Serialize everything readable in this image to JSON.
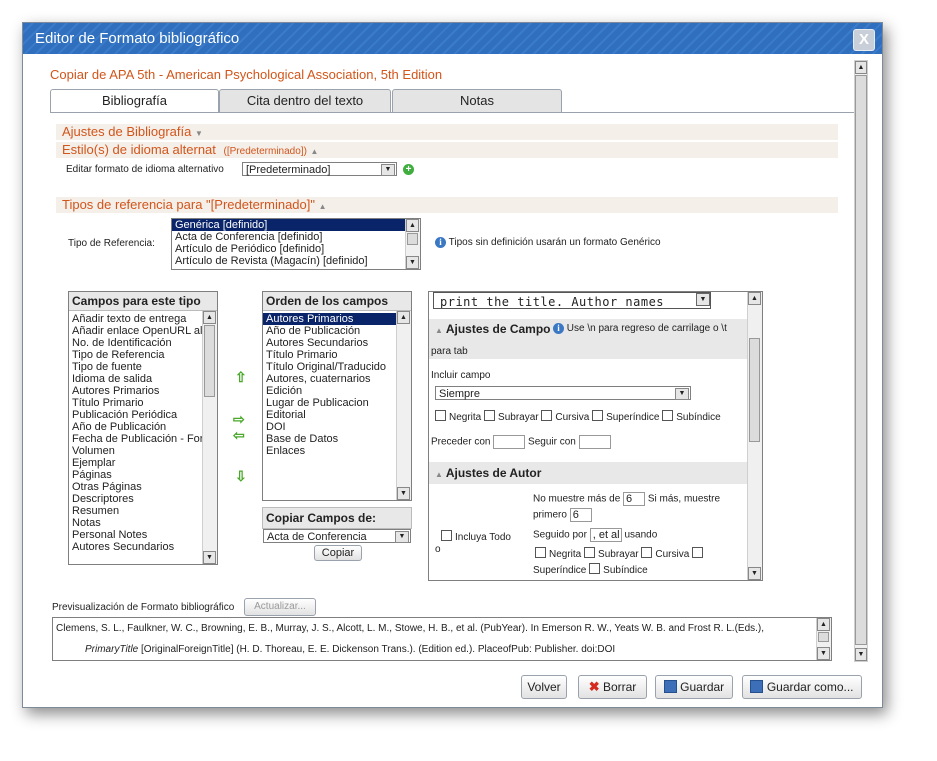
{
  "dialog": {
    "title": "Editor de Formato bibliográfico",
    "close": "X",
    "subtitle": "Copiar de APA 5th - American Psychological Association, 5th Edition"
  },
  "tabs": [
    {
      "label": "Bibliografía",
      "active": true
    },
    {
      "label": "Cita dentro del texto",
      "active": false
    },
    {
      "label": "Notas",
      "active": false
    }
  ],
  "sections": {
    "ajustes": "Ajustes de Bibliografía",
    "idioma": "Estilo(s) de idioma alternat",
    "idioma_badge": "([Predeterminado])",
    "editar_label": "Editar formato de idioma alternativo",
    "editar_value": "[Predeterminado]",
    "tipos": "Tipos de referencia para \"[Predeterminado]\""
  },
  "tipo_referencia": {
    "label": "Tipo de Referencia:",
    "items": [
      "Genérica [definido]",
      "Acta de Conferencia [definido]",
      "Artículo de Periódico [definido]",
      "Artículo de Revista (Magacín) [definido]"
    ],
    "selected": 0,
    "hint": "Tipos sin definición usarán un formato Genérico"
  },
  "campos": {
    "header": "Campos para este tipo",
    "items": [
      "Añadir texto de entrega",
      "Añadir enlace OpenURL al d",
      "No. de Identificación",
      "Tipo de Referencia",
      "Tipo de fuente",
      "Idioma de salida",
      "Autores Primarios",
      "Título Primario",
      "Publicación Periódica",
      "Año de Publicación",
      "Fecha de Publicación - Form",
      "Volumen",
      "Ejemplar",
      "Páginas",
      "Otras Páginas",
      "Descriptores",
      "Resumen",
      "Notas",
      "Personal Notes",
      "Autores Secundarios"
    ]
  },
  "orden": {
    "header": "Orden de los campos",
    "items": [
      "Autores Primarios",
      "Año de Publicación",
      "Autores Secundarios",
      "Título Primario",
      "Título Original/Traducido",
      "Autores, cuaternarios",
      "Edición",
      "Lugar de Publicacion",
      "Editorial",
      "DOI",
      "Base de Datos",
      "Enlaces"
    ],
    "selected": 0
  },
  "copiar": {
    "header": "Copiar Campos de:",
    "value": "Acta de Conferencia",
    "button": "Copiar"
  },
  "ajustes_campo": {
    "code_line": "print the title. Author names",
    "header": "Ajustes de Campo",
    "hint_a": "Use \\n para regreso de carrilage o \\t",
    "hint_b": "para tab",
    "incluir_label": "Incluir campo",
    "incluir_value": "Siempre",
    "checks": [
      "Negrita",
      "Subrayar",
      "Cursiva",
      "Superíndice",
      "Subíndice"
    ],
    "preceder": "Preceder con",
    "seguir": "Seguir con"
  },
  "ajustes_autor": {
    "header": "Ajustes de Autor",
    "no_muestre": "No muestre más de",
    "no_muestre_val": "6",
    "si_mas": "Si más, muestre",
    "primero": "primero",
    "primero_val": "6",
    "incluya": "Incluya Todo",
    "incluya_b": "o",
    "seguido": "Seguido por",
    "seguido_val": ", et al",
    "usando": "usando",
    "checks_a": [
      "Negrita",
      "Subrayar",
      "Cursiva"
    ],
    "checks_b": [
      "Superíndice",
      "Subíndice"
    ]
  },
  "preview": {
    "label": "Previsualización de Formato bibliográfico",
    "update": "Actualizar...",
    "line1": "Clemens, S. L., Faulkner, W. C., Browning, E. B., Murray, J. S., Alcott, L. M., Stowe, H. B., et al. (PubYear). In Emerson R. W., Yeats W. B. and Frost R. L.(Eds.),",
    "line2_italic": "PrimaryTitle",
    "line2_rest": " [OriginalForeignTitle] (H. D. Thoreau, E. E. Dickenson Trans.). (Edition ed.). PlaceofPub: Publisher. doi:DOI"
  },
  "footer": {
    "volver": "Volver",
    "borrar": "Borrar",
    "guardar": "Guardar",
    "guardar_como": "Guardar como..."
  },
  "colors": {
    "accent": "#d2551a",
    "titlebar": "#2f6fbd",
    "selection": "#0a246a"
  }
}
